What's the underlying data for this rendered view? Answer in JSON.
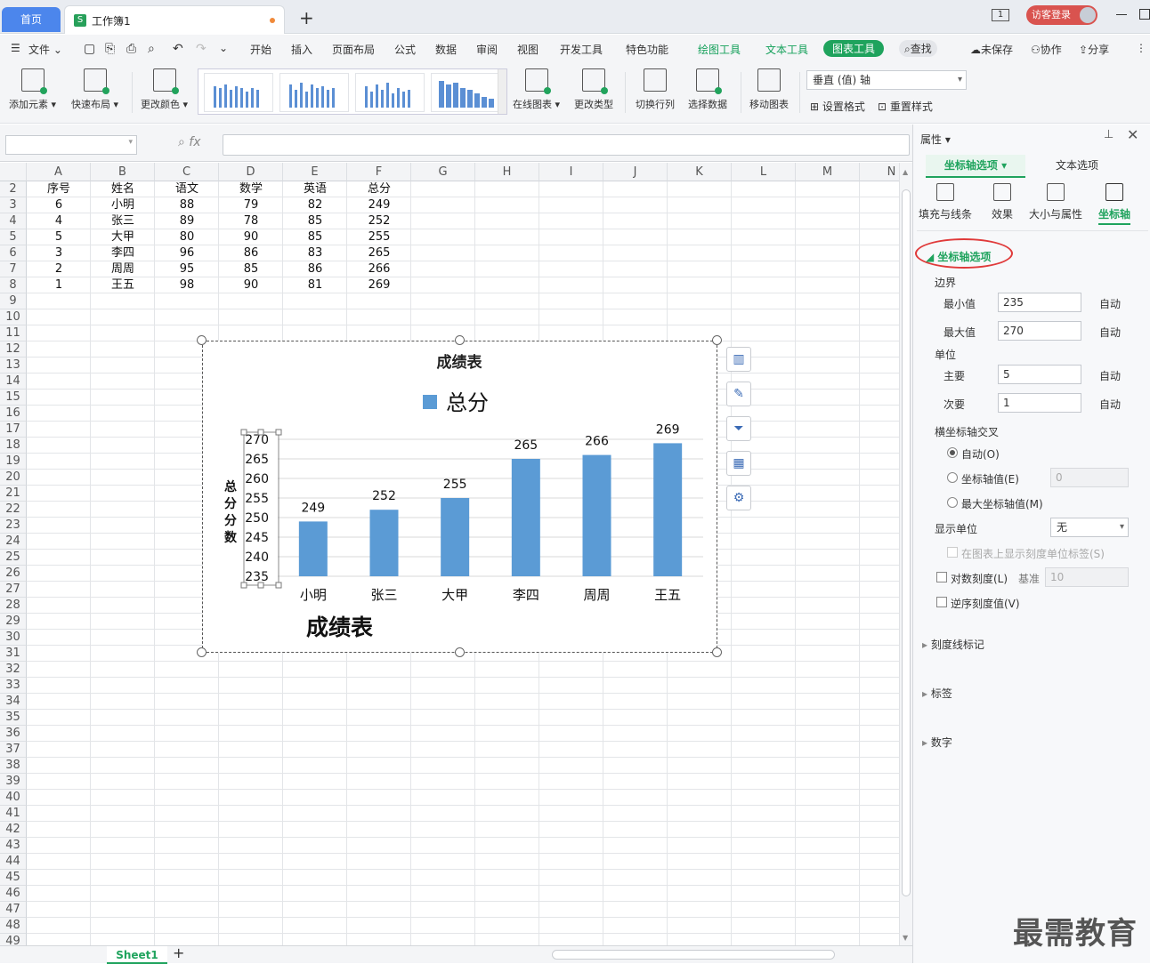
{
  "tabs": {
    "home": "首页",
    "doc": "工作簿1",
    "doc_icon": "S"
  },
  "window": {
    "login": "访客登录",
    "mon": "1"
  },
  "menu": {
    "file": "文件",
    "items": [
      "开始",
      "插入",
      "页面布局",
      "公式",
      "数据",
      "审阅",
      "视图",
      "开发工具",
      "特色功能"
    ],
    "tool_tabs": [
      "绘图工具",
      "文本工具",
      "图表工具"
    ],
    "search": "查找",
    "right": [
      "未保存",
      "协作",
      "分享"
    ]
  },
  "ribbon": {
    "buttons": [
      "添加元素",
      "快速布局",
      "更改颜色",
      "在线图表",
      "更改类型",
      "切换行列",
      "选择数据",
      "移动图表"
    ],
    "axis_select": "垂直 (值) 轴",
    "set_format": "设置格式",
    "reset_style": "重置样式"
  },
  "grid": {
    "columns": [
      "A",
      "B",
      "C",
      "D",
      "E",
      "F",
      "G",
      "H",
      "I",
      "J",
      "K",
      "L",
      "M",
      "N"
    ],
    "rows": [
      2,
      3,
      4,
      5,
      6,
      7,
      8,
      9,
      10,
      11,
      12,
      13,
      14,
      15,
      16,
      17,
      18,
      19,
      20,
      21,
      22,
      23,
      24,
      25,
      26,
      27,
      28,
      29,
      30,
      31,
      32,
      33,
      34,
      35,
      36,
      37,
      38,
      39,
      40,
      41,
      42,
      43,
      44,
      45,
      46,
      47,
      48,
      49
    ],
    "header": [
      "序号",
      "姓名",
      "语文",
      "数学",
      "英语",
      "总分"
    ],
    "data": [
      [
        "6",
        "小明",
        "88",
        "79",
        "82",
        "249"
      ],
      [
        "4",
        "张三",
        "89",
        "78",
        "85",
        "252"
      ],
      [
        "5",
        "大甲",
        "80",
        "90",
        "85",
        "255"
      ],
      [
        "3",
        "李四",
        "96",
        "86",
        "83",
        "265"
      ],
      [
        "2",
        "周周",
        "95",
        "85",
        "86",
        "266"
      ],
      [
        "1",
        "王五",
        "98",
        "90",
        "81",
        "269"
      ]
    ]
  },
  "sheet": {
    "name": "Sheet1"
  },
  "chart_data": {
    "type": "bar",
    "title": "成绩表",
    "bottom_title": "成绩表",
    "legend": "总分",
    "legend_position": "top",
    "ylabel": "总分分数",
    "categories": [
      "小明",
      "张三",
      "大甲",
      "李四",
      "周周",
      "王五"
    ],
    "series": [
      {
        "name": "总分",
        "values": [
          249,
          252,
          255,
          265,
          266,
          269
        ],
        "color": "#5b9bd5"
      }
    ],
    "ylim": [
      235,
      270
    ],
    "yticks": [
      235,
      240,
      245,
      250,
      255,
      260,
      265,
      270
    ],
    "grid": true
  },
  "panel": {
    "title": "属性",
    "tab1": "坐标轴选项",
    "tab2": "文本选项",
    "subtabs": [
      "填充与线条",
      "效果",
      "大小与属性",
      "坐标轴"
    ],
    "section": "坐标轴选项",
    "bounds": "边界",
    "min_label": "最小值",
    "min_value": "235",
    "min_auto": "自动",
    "max_label": "最大值",
    "max_value": "270",
    "max_auto": "自动",
    "unit": "单位",
    "major_label": "主要",
    "major_value": "5",
    "major_auto": "自动",
    "minor_label": "次要",
    "minor_value": "1",
    "minor_auto": "自动",
    "cross": "横坐标轴交叉",
    "cross_auto": "自动(O)",
    "cross_value": "坐标轴值(E)",
    "cross_value_input": "0",
    "cross_max": "最大坐标轴值(M)",
    "display_unit": "显示单位",
    "display_unit_value": "无",
    "show_unit_label": "在图表上显示刻度单位标签(S)",
    "log_scale": "对数刻度(L)",
    "base_label": "基准",
    "base_value": "10",
    "reverse": "逆序刻度值(V)",
    "sections": [
      "刻度线标记",
      "标签",
      "数字"
    ]
  },
  "watermark": "最需教育"
}
